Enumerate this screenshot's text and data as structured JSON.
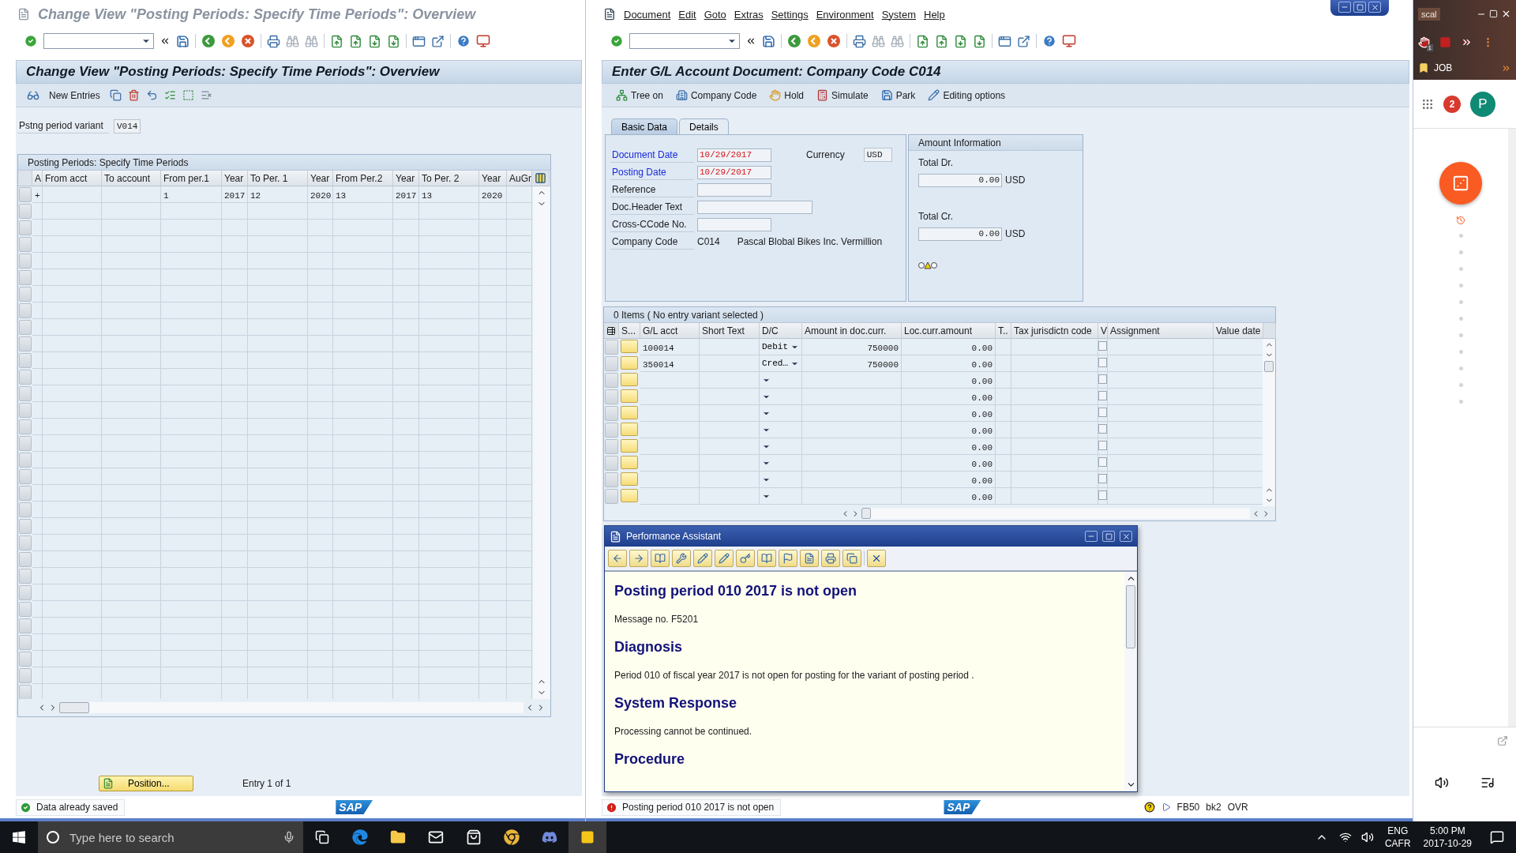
{
  "left_window": {
    "title": "Change View \"Posting Periods: Specify Time Periods\": Overview",
    "header": "Change View \"Posting Periods: Specify Time Periods\": Overview",
    "new_entries": "New Entries",
    "variant": {
      "label": "Pstng period variant",
      "value": "V014"
    },
    "table": {
      "title": "Posting Periods: Specify Time Periods",
      "columns": [
        "A",
        "From acct",
        "To account",
        "From per.1",
        "Year",
        "To Per. 1",
        "Year",
        "From Per.2",
        "Year",
        "To Per. 2",
        "Year",
        "AuGr"
      ],
      "rows": [
        {
          "cells": [
            "+",
            null,
            null,
            "1",
            "2017",
            "12",
            "2020",
            "13",
            "2017",
            "13",
            "2020",
            null
          ]
        }
      ]
    },
    "position_button": "Position...",
    "entry_info": "Entry 1 of 1",
    "status": {
      "kind": "success",
      "text": "Data already saved"
    },
    "logo": "SAP"
  },
  "right_window": {
    "menu": [
      "Document",
      "Edit",
      "Goto",
      "Extras",
      "Settings",
      "Environment",
      "System",
      "Help"
    ],
    "header": "Enter G/L Account Document: Company Code C014",
    "app_toolbar": [
      {
        "kind": "tree",
        "label": "Tree on"
      },
      {
        "kind": "company",
        "label": "Company Code"
      },
      {
        "kind": "hold",
        "label": "Hold"
      },
      {
        "kind": "simulate",
        "label": "Simulate"
      },
      {
        "kind": "park",
        "label": "Park"
      },
      {
        "kind": "edit",
        "label": "Editing options"
      }
    ],
    "tabs": [
      {
        "label": "Basic Data",
        "selected": true
      },
      {
        "label": "Details",
        "selected": false
      }
    ],
    "fields": [
      {
        "label": "Document Date",
        "required": true,
        "highlighted": true,
        "value": "10/29/2017"
      },
      {
        "label": "Posting Date",
        "required": true,
        "highlighted": true,
        "value": "10/29/2017"
      },
      {
        "label": "Reference",
        "required": false
      },
      {
        "label": "Doc.Header Text",
        "required": false
      },
      {
        "label": "Cross-CCode No.",
        "required": false
      }
    ],
    "currency": {
      "label": "Currency",
      "value": "USD"
    },
    "company": {
      "label": "Company Code",
      "code": "C014",
      "name": "Pascal Blobal Bikes Inc. Vermillion"
    },
    "amount_info": {
      "title": "Amount Information",
      "totals": [
        {
          "label": "Total Dr.",
          "value": "0.00",
          "currency": "USD"
        },
        {
          "label": "Total Cr.",
          "value": "0.00",
          "currency": "USD"
        }
      ]
    },
    "items": {
      "title": "0 Items ( No entry variant selected )",
      "columns": [
        "S...",
        "G/L acct",
        "Short Text",
        "D/C",
        "Amount in doc.curr.",
        "Loc.curr.amount",
        "T..",
        "Tax jurisdictn code",
        "V",
        "Assignment",
        "Value date"
      ],
      "rows": [
        {
          "gl_acct": "100014",
          "dc": "Debit",
          "amount": "750000",
          "loc_amount": "0.00",
          "v_checked": false
        },
        {
          "gl_acct": "350014",
          "dc": "Cred…",
          "amount": "750000",
          "loc_amount": "0.00",
          "v_checked": false
        },
        {
          "loc_amount": "0.00",
          "v_checked": false
        },
        {
          "loc_amount": "0.00",
          "v_checked": false
        },
        {
          "loc_amount": "0.00",
          "v_checked": false
        },
        {
          "loc_amount": "0.00",
          "v_checked": false
        },
        {
          "loc_amount": "0.00",
          "v_checked": false
        },
        {
          "loc_amount": "0.00",
          "v_checked": false
        },
        {
          "loc_amount": "0.00",
          "v_checked": false
        },
        {
          "loc_amount": "0.00",
          "v_checked": false
        }
      ]
    },
    "status": {
      "kind": "error",
      "text": "Posting period 010 2017 is not open"
    },
    "logo": "SAP",
    "status_info": [
      "FB50",
      "bk2",
      "OVR"
    ]
  },
  "assistant": {
    "title": "Performance Assistant",
    "content": [
      {
        "kind": "heading",
        "text": "Posting period 010 2017 is not open"
      },
      {
        "kind": "paragraph",
        "text": "Message no. F5201"
      },
      {
        "kind": "heading",
        "text": "Diagnosis"
      },
      {
        "kind": "paragraph",
        "text": "Period 010 of fiscal year 2017 is not open for posting for the variant of posting period ."
      },
      {
        "kind": "heading",
        "text": "System Response"
      },
      {
        "kind": "paragraph",
        "text": "Processing cannot be continued."
      },
      {
        "kind": "heading",
        "text": "Procedure"
      }
    ]
  },
  "browser": {
    "tab": "scal",
    "extension_badge": "1",
    "bookmark": "JOB",
    "notifications": "2",
    "avatar": "P"
  },
  "taskbar": {
    "search_placeholder": "Type here to search",
    "language": "ENG",
    "layout": "CAFR",
    "time": "5:00 PM",
    "date": "2017-10-29"
  }
}
